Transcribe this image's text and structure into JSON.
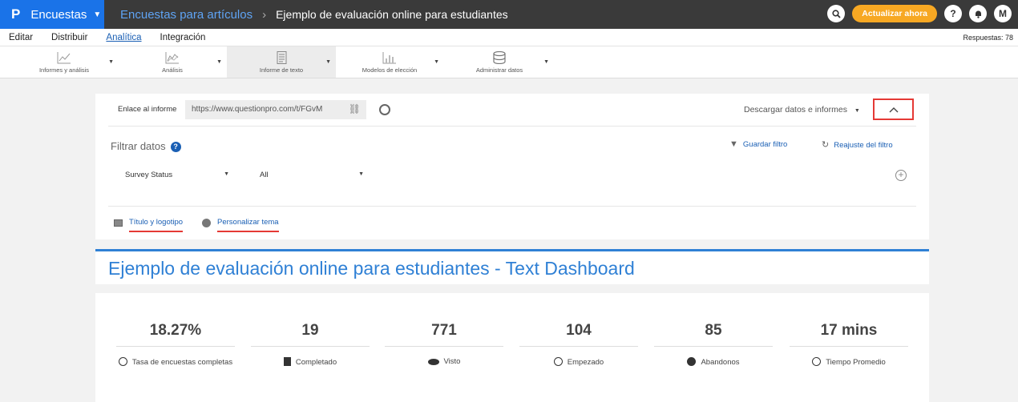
{
  "topbar": {
    "brand_logo": "P",
    "brand": "Encuestas",
    "breadcrumb_parent": "Encuestas para artículos",
    "breadcrumb_sep": "›",
    "breadcrumb_current": "Ejemplo de evaluación online para estudiantes",
    "upgrade_label": "Actualizar ahora",
    "help_label": "?",
    "avatar": "M"
  },
  "menu": {
    "items": [
      "Editar",
      "Distribuir",
      "Analítica",
      "Integración"
    ],
    "active": "Analítica",
    "responses": "Respuestas: 78"
  },
  "toolbar": {
    "items": [
      {
        "label": "Informes y análisis",
        "icon": "line-chart-icon"
      },
      {
        "label": "Análisis",
        "icon": "area-chart-icon"
      },
      {
        "label": "Informe de texto",
        "icon": "document-icon"
      },
      {
        "label": "Modelos de elección",
        "icon": "bar-chart-icon"
      },
      {
        "label": "Administrar datos",
        "icon": "database-icon"
      }
    ],
    "active": "Informe de texto"
  },
  "report_link": {
    "label": "Enlace al informe",
    "url": "https://www.questionpro.com/t/FGvM"
  },
  "download_label": "Descargar datos e informes",
  "filter": {
    "title": "Filtrar datos",
    "save_label": "Guardar filtro",
    "reset_label": "Reajuste del filtro",
    "field": "Survey Status",
    "value": "All"
  },
  "theme": {
    "title_logo": "Título y logotipo",
    "customize": "Personalizar tema"
  },
  "dashboard_title": "Ejemplo de evaluación online para estudiantes - Text Dashboard",
  "stats": [
    {
      "value": "18.27%",
      "label": "Tasa de encuestas completas",
      "icon": "pie-icon"
    },
    {
      "value": "19",
      "label": "Completado",
      "icon": "flag-icon"
    },
    {
      "value": "771",
      "label": "Visto",
      "icon": "eye-icon"
    },
    {
      "value": "104",
      "label": "Empezado",
      "icon": "play-icon"
    },
    {
      "value": "85",
      "label": "Abandonos",
      "icon": "minus-circle-icon"
    },
    {
      "value": "17 mins",
      "label": "Tiempo Promedio",
      "icon": "clock-icon"
    }
  ],
  "colors": {
    "brand": "#1a73e8",
    "topbar": "#3a3a3a",
    "upgrade": "#f7a823",
    "link": "#1a5fb4",
    "title": "#2f80d5",
    "highlight": "#e53935"
  }
}
